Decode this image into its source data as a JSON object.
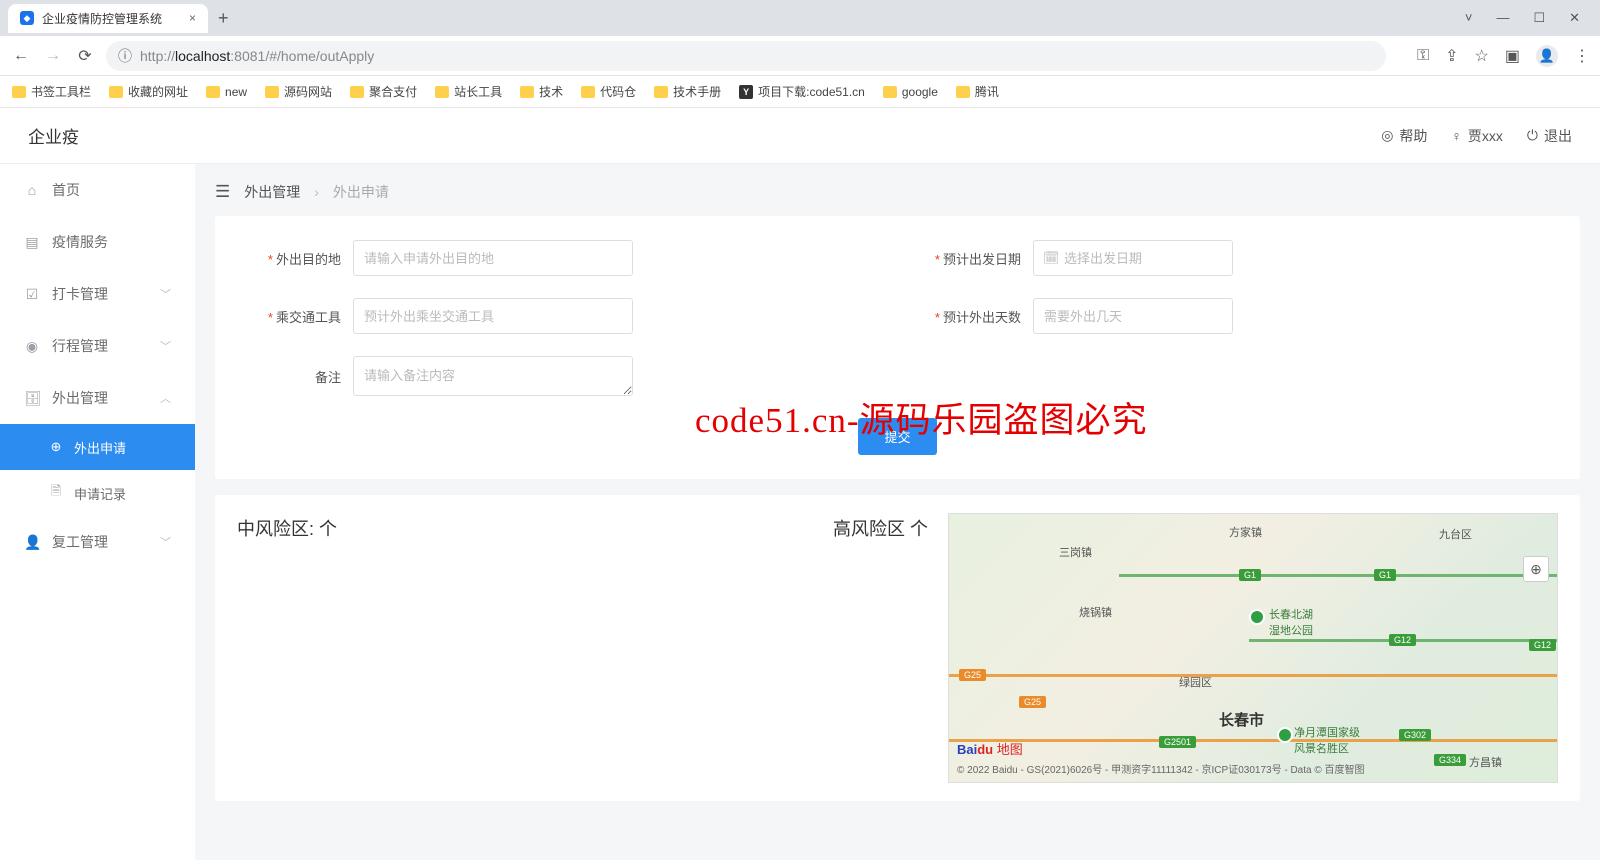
{
  "browser": {
    "tab_title": "企业疫情防控管理系统",
    "url_pre": "http://",
    "url_host": "localhost",
    "url_rest": ":8081/#/home/outApply",
    "bookmarks": [
      "书签工具栏",
      "收藏的网址",
      "new",
      "源码网站",
      "聚合支付",
      "站长工具",
      "技术",
      "代码仓",
      "技术手册",
      "项目下载:code51.cn",
      "google",
      "腾讯"
    ]
  },
  "app": {
    "logo": "企业疫",
    "header": {
      "help": "帮助",
      "user": "贾xxx",
      "logout": "退出"
    }
  },
  "sidebar": {
    "items": [
      {
        "icon": "home",
        "label": "首页"
      },
      {
        "icon": "monitor",
        "label": "疫情服务"
      },
      {
        "icon": "check",
        "label": "打卡管理",
        "caret": true
      },
      {
        "icon": "pin",
        "label": "行程管理",
        "caret": true
      },
      {
        "icon": "briefcase",
        "label": "外出管理",
        "caret": true,
        "expanded": true,
        "children": [
          {
            "icon": "plus",
            "label": "外出申请",
            "active": true
          },
          {
            "icon": "doc",
            "label": "申请记录"
          }
        ]
      },
      {
        "icon": "user",
        "label": "复工管理",
        "caret": true
      }
    ]
  },
  "breadcrumb": {
    "a": "外出管理",
    "b": "外出申请"
  },
  "form": {
    "dest_label": "外出目的地",
    "dest_ph": "请输入申请外出目的地",
    "date_label": "预计出发日期",
    "date_ph": "选择出发日期",
    "vehicle_label": "乘交通工具",
    "vehicle_ph": "预计外出乘坐交通工具",
    "days_label": "预计外出天数",
    "days_ph": "需要外出几天",
    "note_label": "备注",
    "note_ph": "请输入备注内容",
    "submit": "提交"
  },
  "watermark": "code51.cn-源码乐园盗图必究",
  "risk": {
    "mid": "中风险区:  个",
    "high": "高风险区  个"
  },
  "map": {
    "city": "长春市",
    "places": [
      "三岗镇",
      "烧锅镇",
      "方家镇",
      "九台区",
      "绿园区",
      "方昌镇"
    ],
    "parks": [
      "长春北湖\n湿地公园",
      "净月潭国家级\n风景名胜区"
    ],
    "roads_orange": [
      "G25",
      "G25"
    ],
    "roads_green": [
      "G1",
      "G1",
      "G12",
      "G12",
      "G2501",
      "G302",
      "G334"
    ],
    "logo_a": "Bai",
    "logo_b": "du",
    "logo_c": "地图",
    "copyright": "© 2022 Baidu - GS(2021)6026号 - 甲测资字11111342 - 京ICP证030173号 - Data © 百度智图"
  }
}
